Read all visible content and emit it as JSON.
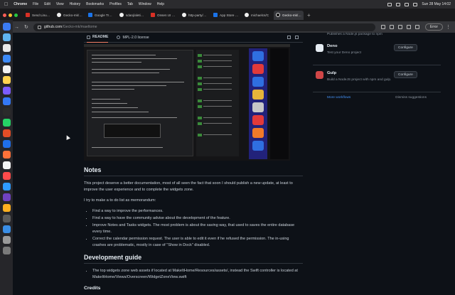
{
  "menubar": {
    "app": "Chrome",
    "items": [
      "File",
      "Edit",
      "View",
      "History",
      "Bookmarks",
      "Profiles",
      "Tab",
      "Window",
      "Help"
    ],
    "clock": "Sun 28 May 14:02"
  },
  "tabs": [
    {
      "title": "Send Linux Com"
    },
    {
      "title": "Gecko-mk/Mac"
    },
    {
      "title": "Google Traduct"
    },
    {
      "title": "sdanj/aletima"
    },
    {
      "title": "Onsen UI 2: Bea"
    },
    {
      "title": "http-party/node"
    },
    {
      "title": "App Store Conn"
    },
    {
      "title": "michaelcs/C"
    },
    {
      "title": "Gecko-mk/Mac"
    }
  ],
  "toolbar": {
    "url_host": "github.com",
    "url_path": "/Gecko-mk/maeltome",
    "error_label": "Error"
  },
  "readme": {
    "tab_readme": "README",
    "tab_license": "MPL-2.0 license",
    "notes_heading": "Notes",
    "notes_p1": "This project deserve a better documentation, most of all seen the fact that soon I should publish a new update, at least to improve the user experience and to complete the widgets zone.",
    "notes_p2": "I try to make a to do list as memorandum:",
    "todo": [
      "Find a way to improve the performances.",
      "Find a way to have the community advise about the development of the feature.",
      "Improve Notes and Tasks widgets. The most problem is about the saving way, that used to saves the entire database every time.",
      "Correct the calendar permission request. The user is able to edit it even if he refused the permission. The in-using crashes are problematic, mostly in case of \"Show in Dock\" disabled."
    ],
    "dev_heading": "Development guide",
    "dev_items": [
      "The top widgets zone web assets if located at MakeItHome/Resources/assets/, instead the Swift controller is located at MakeItHome/Views/Overscreen/WidgetZoneView.swift"
    ],
    "credits_heading": "Credits"
  },
  "sidebar": {
    "top_text": "Publishes a Node.js package to npm",
    "workflows": [
      {
        "name": "Deno",
        "desc": "Test your Deno project",
        "button": "Configure",
        "color": "#e6edf3"
      },
      {
        "name": "Gulp",
        "desc": "Build a NodeJS project with npm and gulp.",
        "button": "Configure",
        "color": "#cf4647"
      }
    ],
    "more_link": "More workflows",
    "dismiss": "Dismiss suggestions"
  },
  "colors": {
    "page_bg": "#0d1117",
    "text": "#c9d1d9",
    "link": "#4493f8",
    "tab_accent": "#f78166"
  }
}
